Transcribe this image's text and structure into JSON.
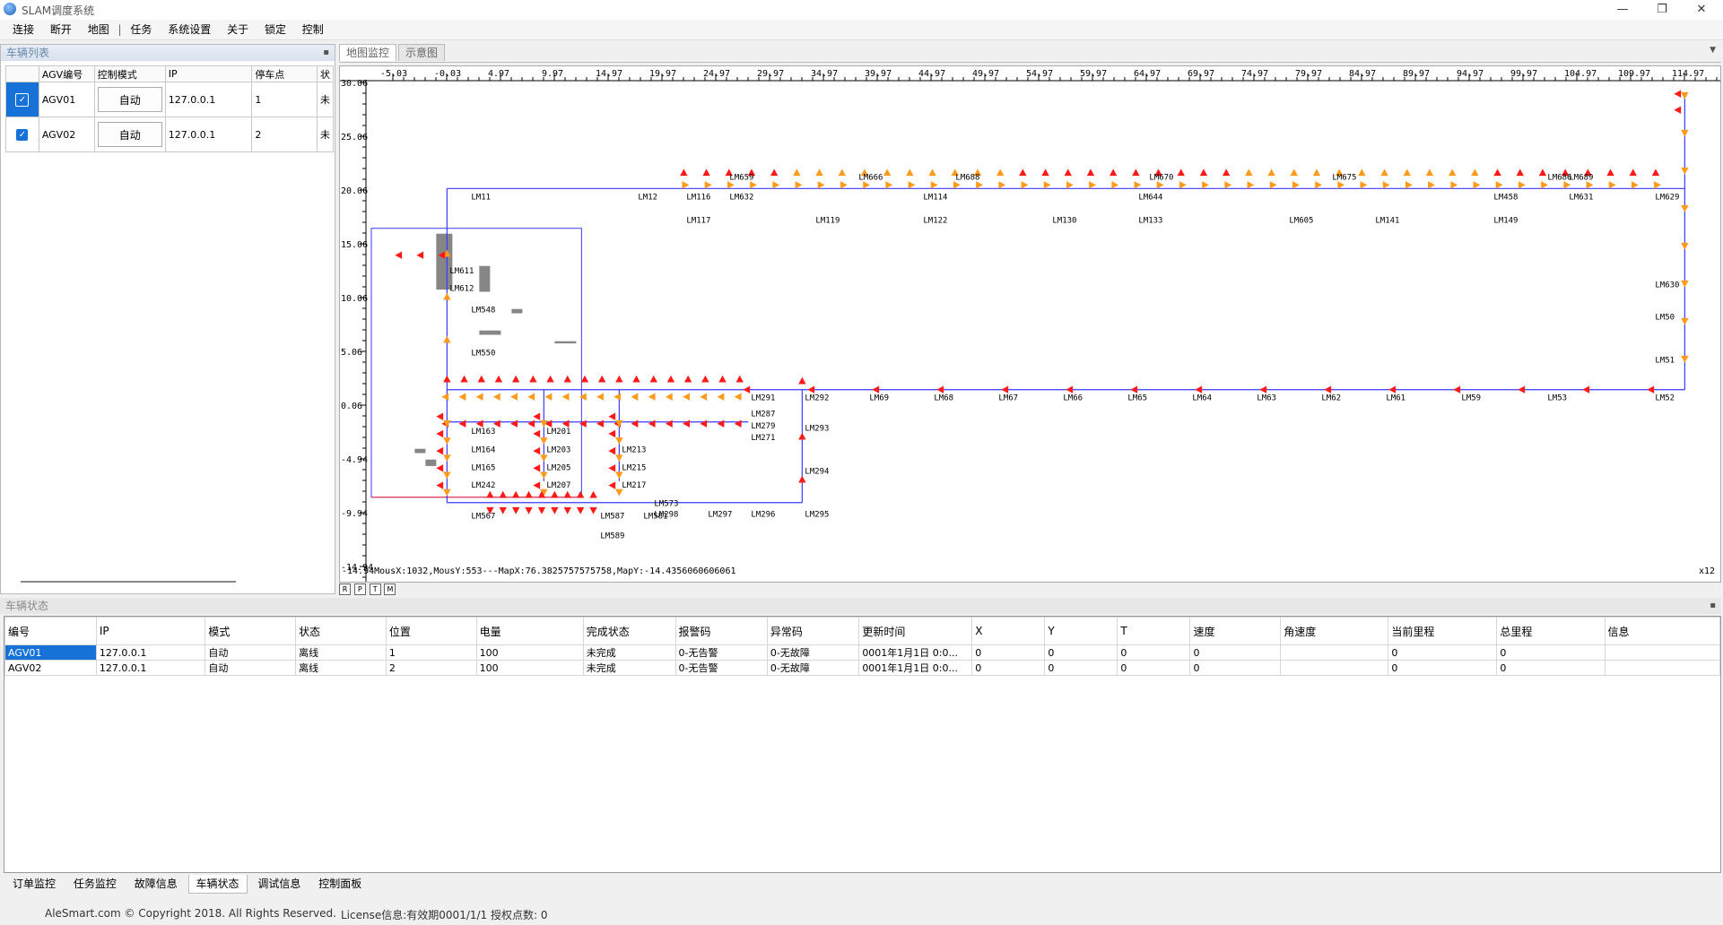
{
  "window": {
    "title": "SLAM调度系统",
    "min_icon": "minimize-icon",
    "max_icon": "restore-icon",
    "close_icon": "close-icon"
  },
  "menu": [
    "连接",
    "断开",
    "地图",
    "任务",
    "系统设置",
    "关于",
    "锁定",
    "控制"
  ],
  "vehicle_list": {
    "title": "车辆列表",
    "columns": [
      "AGV编号",
      "控制模式",
      "IP",
      "停车点",
      "状"
    ],
    "rows": [
      {
        "id": "AGV01",
        "mode": "自动",
        "ip": "127.0.0.1",
        "park": "1",
        "status": "未"
      },
      {
        "id": "AGV02",
        "mode": "自动",
        "ip": "127.0.0.1",
        "park": "2",
        "status": "未"
      }
    ]
  },
  "map": {
    "tabs": [
      "地图监控",
      "示意图"
    ],
    "x_ticks": [
      "-5.03",
      "-0.03",
      "4.97",
      "9.97",
      "14.97",
      "19.97",
      "24.97",
      "29.97",
      "34.97",
      "39.97",
      "44.97",
      "49.97",
      "54.97",
      "59.97",
      "64.97",
      "69.97",
      "74.97",
      "79.97",
      "84.97",
      "89.97",
      "94.97",
      "99.97",
      "104.97",
      "109.97",
      "114.97"
    ],
    "y_ticks": [
      "30.06",
      "25.06",
      "20.06",
      "15.06",
      "10.06",
      "5.06",
      "0.06",
      "-4.94",
      "-9.94",
      "-14.94"
    ],
    "status_text": "MousX:1032,MousY:553---MapX:76.3825757575758,MapY:-14.4356060606061",
    "zoom": "x12",
    "tool_buttons": [
      "R",
      "P",
      "T",
      "M"
    ],
    "route_color": "#3a3aff",
    "arrow_colors": [
      "#ff1a1a",
      "#ff9a1a"
    ],
    "labels": [
      {
        "t": "LM11",
        "x": 2,
        "y": 20.2
      },
      {
        "t": "LM12",
        "x": 17.5,
        "y": 20.2
      },
      {
        "t": "LM659",
        "x": 26,
        "y": 22
      },
      {
        "t": "LM632",
        "x": 26,
        "y": 20.2
      },
      {
        "t": "LM116",
        "x": 22,
        "y": 20.2
      },
      {
        "t": "LM117",
        "x": 22,
        "y": 18
      },
      {
        "t": "LM666",
        "x": 38,
        "y": 22
      },
      {
        "t": "LM688",
        "x": 47,
        "y": 22
      },
      {
        "t": "LM114",
        "x": 44,
        "y": 20.2
      },
      {
        "t": "LM122",
        "x": 44,
        "y": 18
      },
      {
        "t": "LM119",
        "x": 34,
        "y": 18
      },
      {
        "t": "LM130",
        "x": 56,
        "y": 18
      },
      {
        "t": "LM133",
        "x": 64,
        "y": 18
      },
      {
        "t": "LM644",
        "x": 64,
        "y": 20.2
      },
      {
        "t": "LM670",
        "x": 65,
        "y": 22
      },
      {
        "t": "LM675",
        "x": 82,
        "y": 22
      },
      {
        "t": "LM605",
        "x": 78,
        "y": 18
      },
      {
        "t": "LM141",
        "x": 86,
        "y": 18
      },
      {
        "t": "LM458",
        "x": 97,
        "y": 20.2
      },
      {
        "t": "LM149",
        "x": 97,
        "y": 18
      },
      {
        "t": "LM686",
        "x": 102,
        "y": 22
      },
      {
        "t": "LM689",
        "x": 104,
        "y": 22
      },
      {
        "t": "LM631",
        "x": 104,
        "y": 20.2
      },
      {
        "t": "LM629",
        "x": 112,
        "y": 20.2
      },
      {
        "t": "LM630",
        "x": 112,
        "y": 12
      },
      {
        "t": "LM50",
        "x": 112,
        "y": 9
      },
      {
        "t": "LM51",
        "x": 112,
        "y": 5
      },
      {
        "t": "LM52",
        "x": 112,
        "y": 1.5
      },
      {
        "t": "LM53",
        "x": 102,
        "y": 1.5
      },
      {
        "t": "LM59",
        "x": 94,
        "y": 1.5
      },
      {
        "t": "LM61",
        "x": 87,
        "y": 1.5
      },
      {
        "t": "LM62",
        "x": 81,
        "y": 1.5
      },
      {
        "t": "LM63",
        "x": 75,
        "y": 1.5
      },
      {
        "t": "LM64",
        "x": 69,
        "y": 1.5
      },
      {
        "t": "LM65",
        "x": 63,
        "y": 1.5
      },
      {
        "t": "LM66",
        "x": 57,
        "y": 1.5
      },
      {
        "t": "LM67",
        "x": 51,
        "y": 1.5
      },
      {
        "t": "LM68",
        "x": 45,
        "y": 1.5
      },
      {
        "t": "LM69",
        "x": 39,
        "y": 1.5
      },
      {
        "t": "LM292",
        "x": 33,
        "y": 1.5
      },
      {
        "t": "LM291",
        "x": 28,
        "y": 1.5
      },
      {
        "t": "LM293",
        "x": 33,
        "y": -1.3
      },
      {
        "t": "LM294",
        "x": 33,
        "y": -5.3
      },
      {
        "t": "LM295",
        "x": 33,
        "y": -9.3
      },
      {
        "t": "LM296",
        "x": 28,
        "y": -9.3
      },
      {
        "t": "LM297",
        "x": 24,
        "y": -9.3
      },
      {
        "t": "LM298",
        "x": 19,
        "y": -9.3
      },
      {
        "t": "LM548",
        "x": 2,
        "y": 9.7
      },
      {
        "t": "LM550",
        "x": 2,
        "y": 5.7
      },
      {
        "t": "LM163",
        "x": 2,
        "y": -1.6
      },
      {
        "t": "LM164",
        "x": 2,
        "y": -3.3
      },
      {
        "t": "LM165",
        "x": 2,
        "y": -5
      },
      {
        "t": "LM242",
        "x": 2,
        "y": -6.6
      },
      {
        "t": "LM567",
        "x": 2,
        "y": -9.5
      },
      {
        "t": "LM201",
        "x": 9,
        "y": -1.6
      },
      {
        "t": "LM203",
        "x": 9,
        "y": -3.3
      },
      {
        "t": "LM205",
        "x": 9,
        "y": -5
      },
      {
        "t": "LM207",
        "x": 9,
        "y": -6.6
      },
      {
        "t": "LM213",
        "x": 16,
        "y": -3.3
      },
      {
        "t": "LM215",
        "x": 16,
        "y": -5
      },
      {
        "t": "LM217",
        "x": 16,
        "y": -6.6
      },
      {
        "t": "LM279",
        "x": 28,
        "y": -1.1
      },
      {
        "t": "LM271",
        "x": 28,
        "y": -2.2
      },
      {
        "t": "LM287",
        "x": 28,
        "y": 0
      },
      {
        "t": "LM589",
        "x": 14,
        "y": -11.3
      },
      {
        "t": "LM587",
        "x": 14,
        "y": -9.5
      },
      {
        "t": "LM581",
        "x": 18,
        "y": -9.5
      },
      {
        "t": "LM573",
        "x": 19,
        "y": -8.3
      },
      {
        "t": "LM611",
        "x": 0,
        "y": 13.3
      },
      {
        "t": "LM612",
        "x": 0,
        "y": 11.7
      }
    ]
  },
  "vehicle_status": {
    "title": "车辆状态",
    "columns": [
      "编号",
      "IP",
      "模式",
      "状态",
      "位置",
      "电量",
      "完成状态",
      "报警码",
      "异常码",
      "更新时间",
      "X",
      "Y",
      "T",
      "速度",
      "角速度",
      "当前里程",
      "总里程",
      "信息"
    ],
    "rows": [
      [
        "AGV01",
        "127.0.0.1",
        "自动",
        "离线",
        "1",
        "100",
        "未完成",
        "0-无告警",
        "0-无故障",
        "0001年1月1日 0:0...",
        "0",
        "0",
        "0",
        "0",
        "",
        "0",
        "0",
        ""
      ],
      [
        "AGV02",
        "127.0.0.1",
        "自动",
        "离线",
        "2",
        "100",
        "未完成",
        "0-无告警",
        "0-无故障",
        "0001年1月1日 0:0...",
        "0",
        "0",
        "0",
        "0",
        "",
        "0",
        "0",
        ""
      ]
    ]
  },
  "bottom_tabs": [
    "订单监控",
    "任务监控",
    "故障信息",
    "车辆状态",
    "调试信息",
    "控制面板"
  ],
  "active_bottom_tab": "车辆状态",
  "statusbar": {
    "copyright": "AleSmart.com © Copyright 2018. All Rights Reserved.",
    "license": "License信息:有效期0001/1/1  授权点数: 0"
  }
}
